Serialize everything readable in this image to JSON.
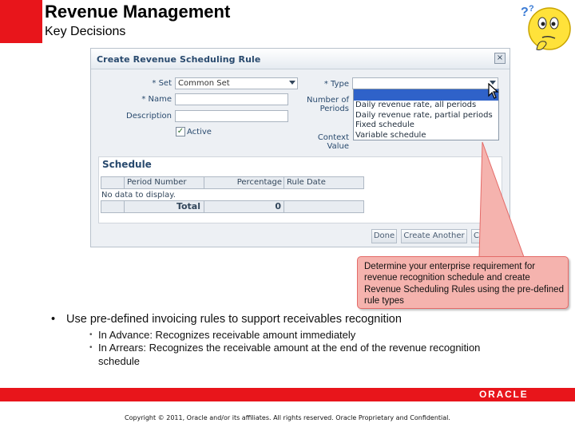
{
  "slide": {
    "title": "Revenue Management",
    "subtitle": "Key Decisions"
  },
  "dialog": {
    "title": "Create Revenue Scheduling Rule",
    "close_label": "×",
    "fields": {
      "set_label": "* Set",
      "set_value": "Common Set",
      "name_label": "* Name",
      "name_value": "",
      "description_label": "Description",
      "description_value": "",
      "active_label": "Active",
      "active_checked": "✓",
      "type_label": "* Type",
      "type_value": "",
      "periods_label_line1": "Number of",
      "periods_label_line2": "Periods",
      "context_label_line1": "Context",
      "context_label_line2": "Value"
    },
    "type_options": [
      "Daily revenue rate, all periods",
      "Daily revenue rate, partial periods",
      "Fixed schedule",
      "Variable schedule"
    ],
    "schedule": {
      "title": "Schedule",
      "columns": [
        "Period Number",
        "Percentage",
        "Rule Date"
      ],
      "empty_text": "No data to display.",
      "total_label": "Total",
      "total_value": "0"
    },
    "buttons": {
      "done": "Done",
      "create_another": "Create Another",
      "cancel_partial": "C"
    }
  },
  "callout": {
    "text": "Determine your enterprise requirement for revenue recognition schedule and create Revenue Scheduling Rules using the pre-defined rule types"
  },
  "bullets": {
    "main_marker": "•",
    "main": "Use pre-defined invoicing rules to support receivables recognition",
    "sub_marker": "•",
    "sub": [
      "In Advance: Recognizes receivable amount immediately",
      "In Arrears: Recognizes the receivable amount at the end of the revenue recognition schedule"
    ]
  },
  "footer": {
    "logo": "ORACLE",
    "copyright": "Copyright © 2011, Oracle and/or its affiliates. All rights reserved. Oracle Proprietary and Confidential."
  },
  "colors": {
    "brand_red": "#e8151b",
    "dialog_label": "#294a6e",
    "callout_fill": "#f5b3ae",
    "selection_blue": "#2f62c9"
  },
  "icons": {
    "thinking_face": "thinking-face-icon",
    "close": "close-icon",
    "dropdown": "chevron-down-icon",
    "cursor": "mouse-pointer-icon",
    "checkbox": "checkbox-icon"
  }
}
